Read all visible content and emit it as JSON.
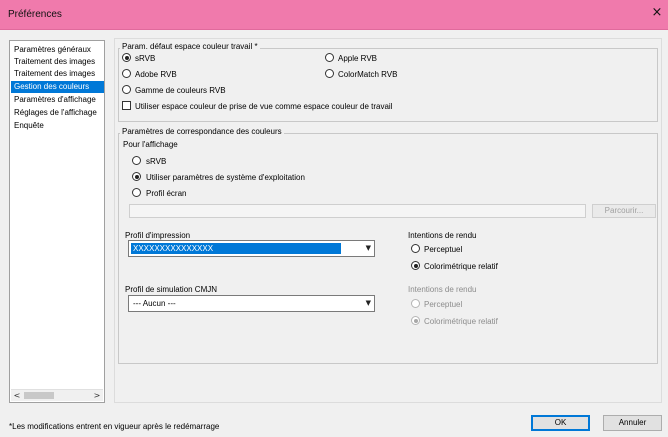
{
  "window": {
    "title": "Préférences",
    "close_glyph": "×"
  },
  "sidebar": {
    "items": [
      {
        "label": "Paramètres généraux",
        "selected": false
      },
      {
        "label": "Traitement des images",
        "selected": false
      },
      {
        "label": "Traitement des images",
        "selected": false
      },
      {
        "label": "Gestion des couleurs",
        "selected": true
      },
      {
        "label": "Paramètres d'affichage",
        "selected": false
      },
      {
        "label": "Réglages de l'affichage",
        "selected": false
      },
      {
        "label": "Enquête",
        "selected": false
      }
    ],
    "scroll_left": "<",
    "scroll_right": ">"
  },
  "workspace": {
    "group_label": "Param. défaut espace couleur travail *",
    "options": {
      "srgb": {
        "label": "sRVB",
        "checked": true
      },
      "apple": {
        "label": "Apple RVB",
        "checked": false
      },
      "adobe": {
        "label": "Adobe RVB",
        "checked": false
      },
      "colormatch": {
        "label": "ColorMatch RVB",
        "checked": false
      },
      "gamut": {
        "label": "Gamme de couleurs RVB",
        "checked": false
      }
    },
    "use_capture_checkbox": {
      "label": "Utiliser espace couleur de prise de vue comme espace couleur de travail",
      "checked": false
    }
  },
  "matching": {
    "group_label": "Paramètres de correspondance des couleurs",
    "display_heading": "Pour l'affichage",
    "display_options": {
      "srgb": {
        "label": "sRVB",
        "checked": false
      },
      "os": {
        "label": "Utiliser paramètres de système d'exploitation",
        "checked": true
      },
      "screen": {
        "label": "Profil écran",
        "checked": false
      }
    },
    "profile_path_value": "",
    "browse_label": "Parcourir...",
    "print_profile": {
      "label": "Profil d'impression",
      "value": "XXXXXXXXXXXXXXX"
    },
    "print_intent": {
      "heading": "Intentions de rendu",
      "perceptual": {
        "label": "Perceptuel",
        "checked": false
      },
      "relative": {
        "label": "Colorimétrique relatif",
        "checked": true
      }
    },
    "cmyk_profile": {
      "label": "Profil de simulation CMJN",
      "value": "--- Aucun ---"
    },
    "cmyk_intent": {
      "heading": "Intentions de rendu",
      "perceptual": {
        "label": "Perceptuel",
        "checked": false
      },
      "relative": {
        "label": "Colorimétrique relatif",
        "checked": true
      }
    }
  },
  "footer": {
    "note": "*Les modifications entrent en vigueur après le redémarrage",
    "ok_label": "OK",
    "cancel_label": "Annuler"
  },
  "colors": {
    "titlebar": "#f07aac",
    "selection": "#0078d7"
  }
}
